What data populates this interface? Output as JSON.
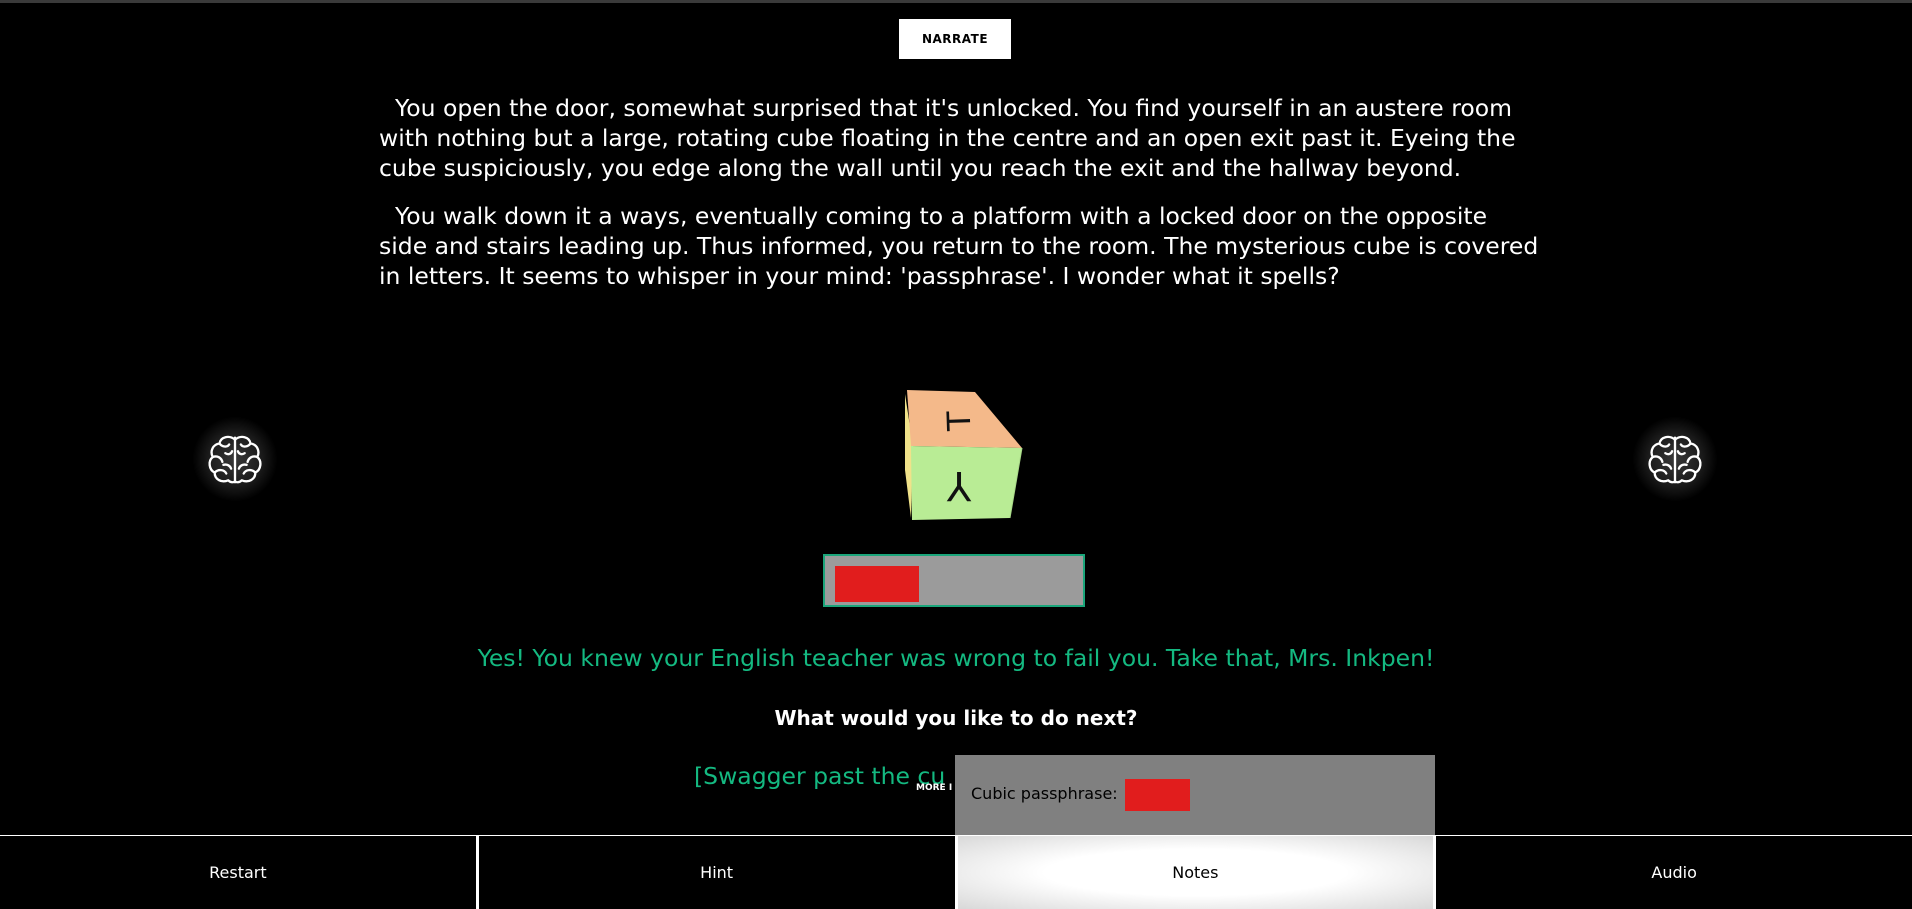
{
  "header": {
    "narrate_label": "NARRATE"
  },
  "story": {
    "paragraphs": [
      "You open the door, somewhat surprised that it's unlocked. You find yourself in an austere room with nothing but a large, rotating cube floating in the centre and an open exit past it. Eyeing the cube suspiciously, you edge along the wall until you reach the exit and the hallway beyond.",
      "You walk down it a ways, eventually coming to a platform with a locked door on the opposite side and stairs leading up. Thus informed, you return to the room. The mysterious cube is covered in letters. It seems to whisper in your mind: 'passphrase'. I wonder what it spells?"
    ]
  },
  "cube": {
    "top_letter": "T",
    "front_letter": "Y",
    "top_color": "#f4b98a",
    "front_color": "#b9ec95",
    "side_color": "#f0e28a"
  },
  "passphrase_input": {
    "redacted_color": "#e11d1d"
  },
  "feedback": {
    "success_text": "Yes! You knew your English teacher was wrong to fail you. Take that, Mrs. Inkpen!"
  },
  "prompt": {
    "question": "What would you like to do next?"
  },
  "choices": [
    {
      "label": "[Swagger past the cu"
    }
  ],
  "more_label": "MORE I",
  "notes": {
    "label": "Cubic passphrase: "
  },
  "nav": {
    "items": [
      {
        "label": "Restart"
      },
      {
        "label": "Hint"
      },
      {
        "label": "Notes"
      },
      {
        "label": "Audio"
      }
    ]
  },
  "colors": {
    "accent_green": "#14b981",
    "redaction_red": "#e11d1d",
    "input_border": "#1aa57a"
  },
  "icons": {
    "brain_left": "brain-icon",
    "brain_right": "brain-icon"
  }
}
